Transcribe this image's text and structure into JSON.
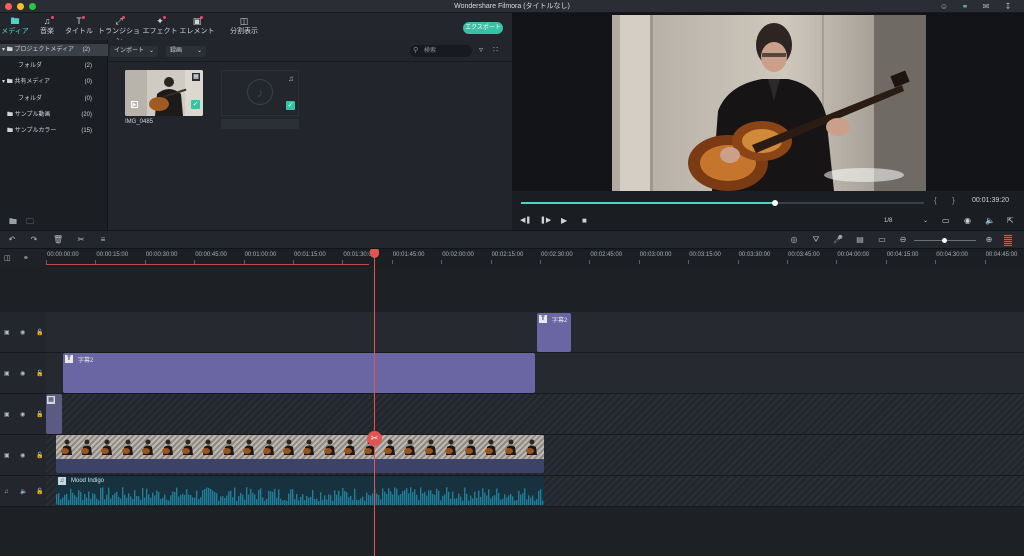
{
  "window": {
    "title": "Wondershare Filmora (タイトルなし)"
  },
  "titlebar_icons": [
    "user-icon",
    "headset-icon",
    "mail-icon",
    "download-icon"
  ],
  "toolbar": {
    "tabs": [
      {
        "label": "メディア",
        "icon": "folder-icon",
        "active": true
      },
      {
        "label": "音楽",
        "icon": "music-icon"
      },
      {
        "label": "タイトル",
        "icon": "title-icon"
      },
      {
        "label": "トランジション",
        "icon": "transition-icon"
      },
      {
        "label": "エフェクト",
        "icon": "effect-icon"
      },
      {
        "label": "エレメント",
        "icon": "element-icon"
      },
      {
        "label": "分割表示",
        "icon": "split-screen-icon"
      }
    ],
    "export_label": "エクスポート"
  },
  "library": {
    "items": [
      {
        "label": "プロジェクトメディア",
        "count": "(2)",
        "expanded": true,
        "selected": true
      },
      {
        "label": "フォルダ",
        "count": "(2)",
        "child": true
      },
      {
        "label": "共有メディア",
        "count": "(0)",
        "expanded": true
      },
      {
        "label": "フォルダ",
        "count": "(0)",
        "child": true
      },
      {
        "label": "サンプル動画",
        "count": "(20)"
      },
      {
        "label": "サンプルカラー",
        "count": "(15)"
      }
    ]
  },
  "media": {
    "import_label": "インポート",
    "record_label": "録画",
    "search_placeholder": "検索",
    "items": [
      {
        "name": "IMG_0485"
      },
      {
        "name": ""
      }
    ]
  },
  "preview": {
    "timecode": "00:01:39:20",
    "quality": "1/8",
    "progress": 0.63
  },
  "timeline": {
    "ruler": [
      "00:00:00:00",
      "00:00:15:00",
      "00:00:30:00",
      "00:00:45:00",
      "00:01:00:00",
      "00:01:15:00",
      "00:01:30:00",
      "00:01:45:00",
      "00:02:00:00",
      "00:02:15:00",
      "00:02:30:00",
      "00:02:45:00",
      "00:03:00:00",
      "00:03:15:00",
      "00:03:30:00",
      "00:03:45:00",
      "00:04:00:00",
      "00:04:15:00",
      "00:04:30:00",
      "00:04:45:00"
    ],
    "clips": {
      "title_top": "字幕2",
      "title_long": "字幕2",
      "audio": "Mood Indigo"
    }
  },
  "colors": {
    "accent": "#4fd1c5",
    "export": "#38c1a4",
    "playhead": "#e4534f",
    "title_clip": "#6a66a3",
    "audio_wave": "#1f7f9a"
  }
}
